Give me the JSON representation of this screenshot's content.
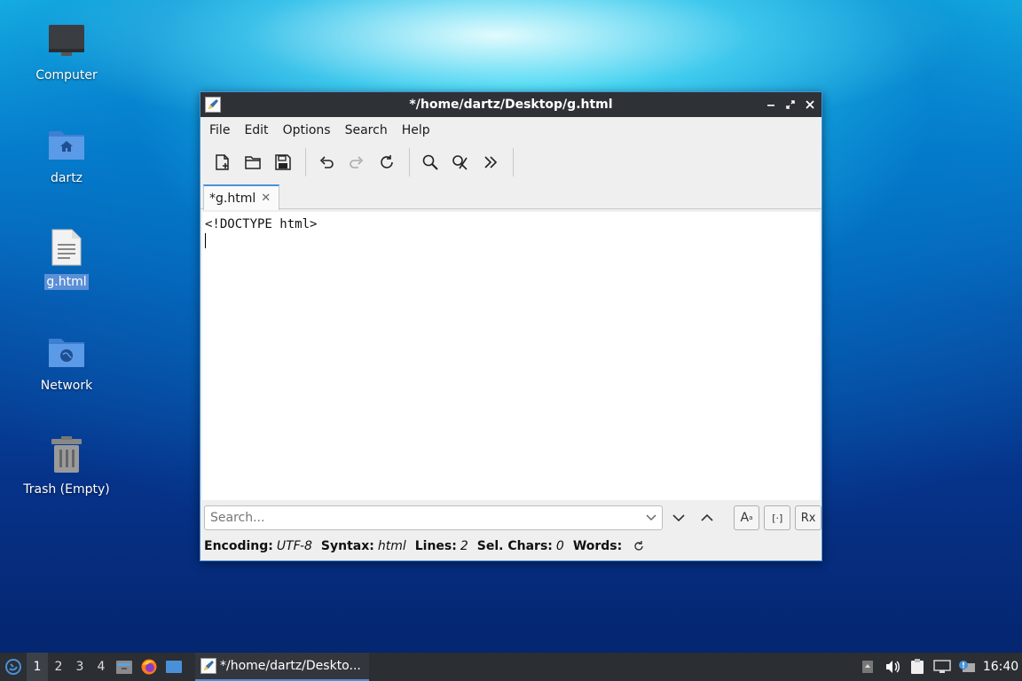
{
  "desktop": {
    "icons": [
      {
        "label": "Computer"
      },
      {
        "label": "dartz"
      },
      {
        "label": "g.html"
      },
      {
        "label": "Network"
      },
      {
        "label": "Trash (Empty)"
      }
    ]
  },
  "window": {
    "title": "*/home/dartz/Desktop/g.html",
    "menu": [
      "File",
      "Edit",
      "Options",
      "Search",
      "Help"
    ],
    "toolbar_icons": [
      "new-file-icon",
      "open-folder-icon",
      "save-icon",
      "undo-icon",
      "redo-icon",
      "reload-icon",
      "find-icon",
      "find-replace-icon",
      "more-icon"
    ],
    "tab": {
      "label": "*g.html",
      "close": "✕"
    },
    "editor_lines": [
      "<!DOCTYPE html>",
      ""
    ],
    "search": {
      "placeholder": "Search...",
      "value": ""
    },
    "search_option_labels": {
      "match_case": "A",
      "whole_word": "[·]",
      "regex": "Rx"
    },
    "status": {
      "encoding_label": "Encoding:",
      "encoding": "UTF-8",
      "syntax_label": "Syntax:",
      "syntax": "html",
      "lines_label": "Lines:",
      "lines": "2",
      "sel_label": "Sel. Chars:",
      "sel": "0",
      "words_label": "Words:"
    }
  },
  "taskbar": {
    "workspaces": [
      "1",
      "2",
      "3",
      "4"
    ],
    "active_workspace": "1",
    "task_title": "*/home/dartz/Deskto...",
    "clock": "16:40"
  },
  "colors": {
    "accent": "#4a90d9",
    "titlebar": "#2e3136",
    "taskbar": "#2b2e33"
  }
}
